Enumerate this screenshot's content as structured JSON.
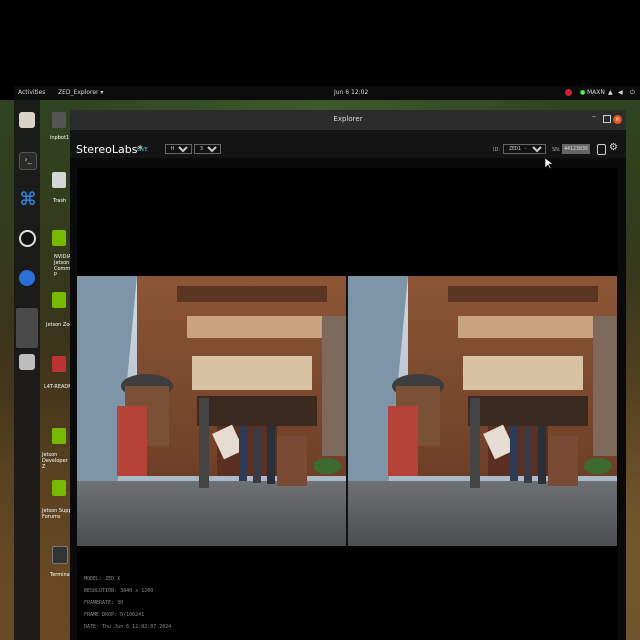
{
  "topbar": {
    "activities": "Activities",
    "app_menu": "ZED_Explorer ▾",
    "clock": "Jun 6  12:02",
    "status": "MAXN",
    "tray": "⏻"
  },
  "desktop": {
    "icons": [
      {
        "label": "inpbot1"
      },
      {
        "label": "Trash"
      },
      {
        "label": "NVIDIA Jetson Community P"
      },
      {
        "label": "Jetson Zoo"
      },
      {
        "label": "L4T-READM"
      },
      {
        "label": "Jetson Developer Z"
      },
      {
        "label": "Jetson Supp Forums"
      },
      {
        "label": "Terminal"
      }
    ]
  },
  "window": {
    "title": "Explorer",
    "brand": "StereoLabs*",
    "live_badge": "LIVE",
    "resolution_option": "HD1200",
    "fps_option": "30",
    "id_label": "ID:",
    "id_option": "ZED1 - 0",
    "sn_label": "SN:",
    "sn_value": "44123836"
  },
  "info": {
    "model": "MODEL: ZED X",
    "resolution": "RESOLUTION: 3840 x 1200",
    "framerate": "FRAMERATE: 30",
    "frame_drop": "FRAME DROP: 0/100241",
    "date": "DATE: Thu Jun 6 12:02:07 2024"
  }
}
